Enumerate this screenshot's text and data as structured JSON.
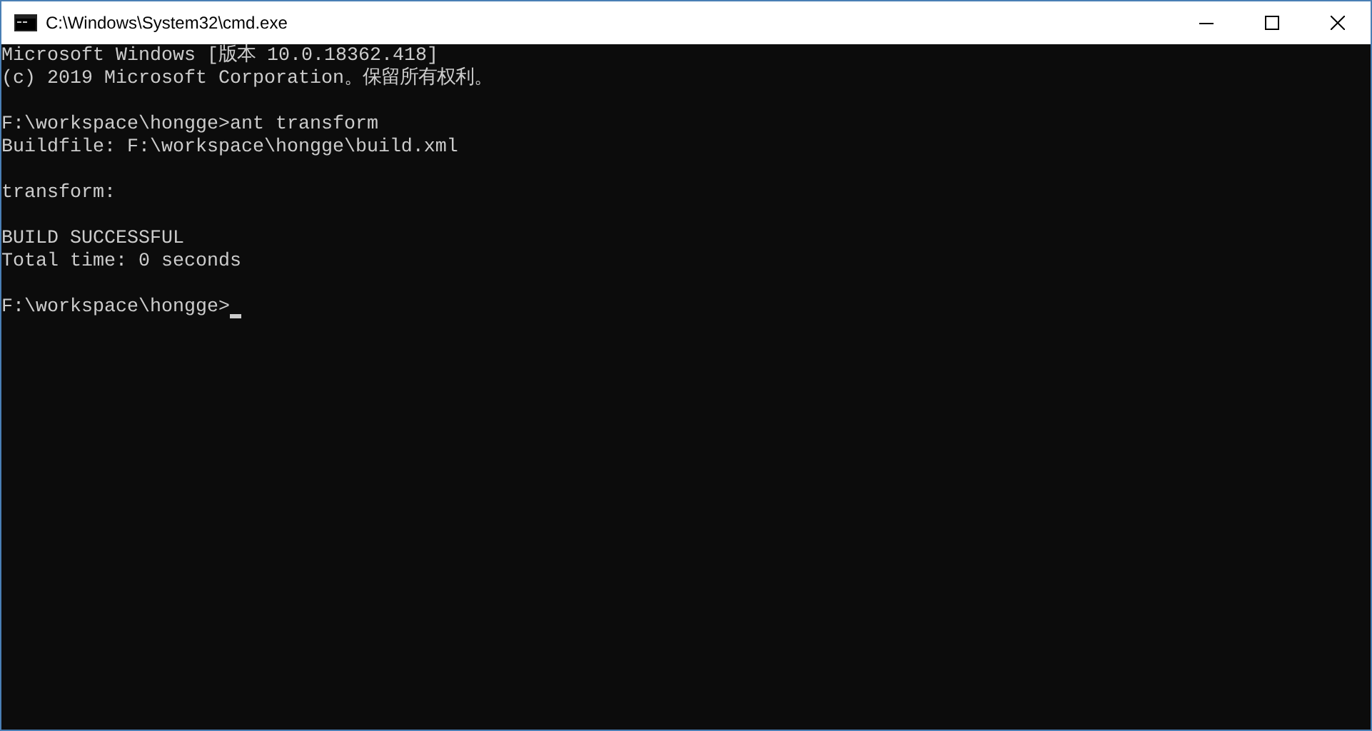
{
  "window": {
    "title": "C:\\Windows\\System32\\cmd.exe"
  },
  "console": {
    "lines": [
      {
        "kind": "text",
        "text": "Microsoft Windows [版本 10.0.18362.418]",
        "cursor": false
      },
      {
        "kind": "text",
        "text": "(c) 2019 Microsoft Corporation。保留所有权利。",
        "cursor": false
      },
      {
        "kind": "blank"
      },
      {
        "kind": "text",
        "text": "F:\\workspace\\hongge>ant transform",
        "cursor": false
      },
      {
        "kind": "text",
        "text": "Buildfile: F:\\workspace\\hongge\\build.xml",
        "cursor": false
      },
      {
        "kind": "blank"
      },
      {
        "kind": "text",
        "text": "transform:",
        "cursor": false
      },
      {
        "kind": "blank"
      },
      {
        "kind": "text",
        "text": "BUILD SUCCESSFUL",
        "cursor": false
      },
      {
        "kind": "text",
        "text": "Total time: 0 seconds",
        "cursor": false
      },
      {
        "kind": "blank"
      },
      {
        "kind": "text",
        "text": "F:\\workspace\\hongge>",
        "cursor": true
      }
    ]
  }
}
